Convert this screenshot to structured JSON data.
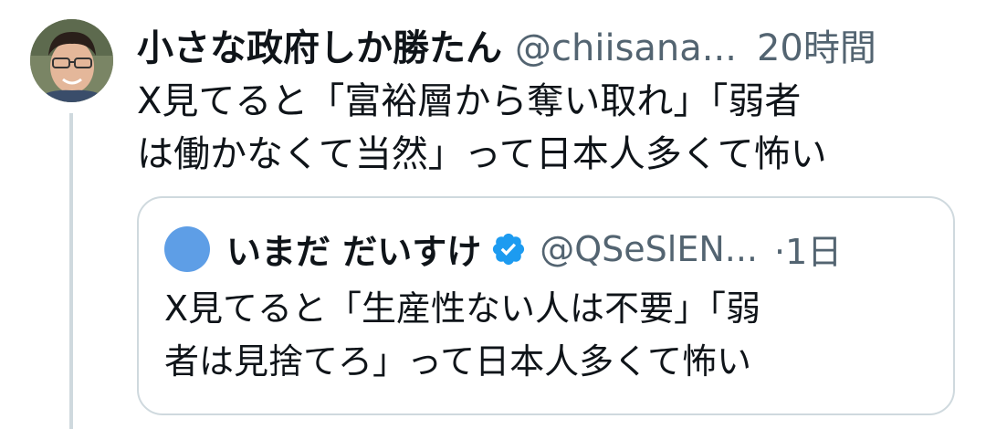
{
  "tweet": {
    "display_name": "小さな政府しか勝たん",
    "handle": "@chiisana...",
    "time": "20時間",
    "text_lines": [
      "X見てると「富裕層から奪い取れ」「弱者",
      "は働かなくて当然」って日本人多くて怖い"
    ]
  },
  "quote": {
    "display_name": "いまだ だいすけ",
    "handle": "@QSeSlEN...",
    "time": "·1日",
    "text_lines": [
      "X見てると「生産性ない人は不要」「弱",
      "者は見捨てろ」って日本人多くて怖い"
    ]
  },
  "colors": {
    "text": "#0f1419",
    "secondary": "#536471",
    "border": "#cfd9de",
    "verified": "#1d9bf0",
    "quote_avatar": "#5e9ee6"
  },
  "icons": {
    "verified": "verified-badge-icon"
  }
}
